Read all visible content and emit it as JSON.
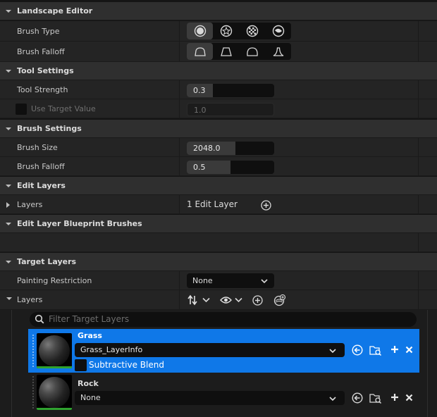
{
  "landscape_editor": {
    "title": "Landscape Editor",
    "brush_type_label": "Brush Type",
    "brush_type_options": [
      "circle-brush-icon",
      "alpha-brush-icon",
      "pattern-brush-icon",
      "component-brush-icon"
    ],
    "brush_falloff_label": "Brush Falloff",
    "brush_falloff_options": [
      "smooth-falloff-icon",
      "linear-falloff-icon",
      "spherical-falloff-icon",
      "tip-falloff-icon"
    ]
  },
  "tool_settings": {
    "title": "Tool Settings",
    "tool_strength_label": "Tool Strength",
    "tool_strength_value": "0.3",
    "tool_strength_fraction": 0.3,
    "use_target_value_label": "Use Target Value",
    "use_target_value_value": "1.0"
  },
  "brush_settings": {
    "title": "Brush Settings",
    "brush_size_label": "Brush Size",
    "brush_size_value": "2048.0",
    "brush_size_fraction": 0.56,
    "brush_falloff_label": "Brush Falloff",
    "brush_falloff_value": "0.5",
    "brush_falloff_fraction": 0.5
  },
  "edit_layers": {
    "title": "Edit Layers",
    "layers_label": "Layers",
    "layers_value": "1 Edit Layer"
  },
  "edit_layer_blueprint_brushes": {
    "title": "Edit Layer Blueprint Brushes"
  },
  "target_layers": {
    "title": "Target Layers",
    "painting_restriction_label": "Painting Restriction",
    "painting_restriction_value": "None",
    "layers_label": "Layers",
    "filter_placeholder": "Filter Target Layers",
    "items": [
      {
        "name": "Grass",
        "layer_info": "Grass_LayerInfo",
        "subtractive_blend_label": "Subtractive Blend",
        "selected": true
      },
      {
        "name": "Rock",
        "layer_info": "None",
        "selected": false
      }
    ]
  },
  "colors": {
    "selection_blue": "#0f78e8",
    "weight_green": "#2fa22f",
    "panel_bg": "#242424",
    "header_bg": "#2f2f2f"
  }
}
